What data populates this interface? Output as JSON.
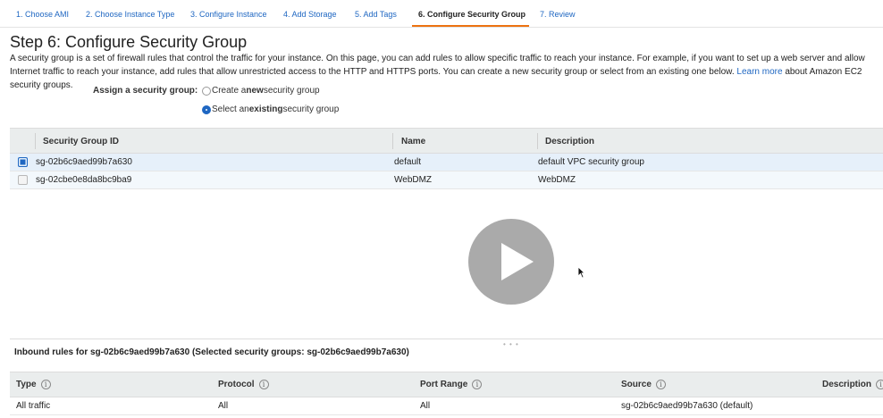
{
  "tabs": [
    {
      "label": "1. Choose AMI"
    },
    {
      "label": "2. Choose Instance Type"
    },
    {
      "label": "3. Configure Instance"
    },
    {
      "label": "4. Add Storage"
    },
    {
      "label": "5. Add Tags"
    },
    {
      "label": "6. Configure Security Group",
      "active": true
    },
    {
      "label": "7. Review"
    }
  ],
  "page": {
    "title": "Step 6: Configure Security Group",
    "description": "A security group is a set of firewall rules that control the traffic for your instance. On this page, you can add rules to allow specific traffic to reach your instance. For example, if you want to set up a web server and allow Internet traffic to reach your instance, add rules that allow unrestricted access to the HTTP and HTTPS ports. You can create a new security group or select from an existing one below.",
    "learn_more": "Learn more",
    "description_tail": "about Amazon EC2 security groups."
  },
  "assign": {
    "label": "Assign a security group:",
    "option_create_pre": "Create a ",
    "option_create_bold": "new",
    "option_create_post": " security group",
    "option_select_pre": "Select an ",
    "option_select_bold": "existing",
    "option_select_post": " security group",
    "selected": "existing"
  },
  "security_groups": {
    "columns": [
      "Security Group ID",
      "Name",
      "Description"
    ],
    "rows": [
      {
        "id": "sg-02b6c9aed99b7a630",
        "name": "default",
        "description": "default VPC security group",
        "checked": true
      },
      {
        "id": "sg-02cbe0e8da8bc9ba9",
        "name": "WebDMZ",
        "description": "WebDMZ",
        "checked": false
      }
    ]
  },
  "inbound": {
    "title": "Inbound rules for sg-02b6c9aed99b7a630 (Selected security groups: sg-02b6c9aed99b7a630)",
    "columns": [
      "Type",
      "Protocol",
      "Port Range",
      "Source",
      "Description"
    ],
    "rows": [
      {
        "type": "All traffic",
        "protocol": "All",
        "port_range": "All",
        "source": "sg-02b6c9aed99b7a630 (default)",
        "description": ""
      }
    ]
  },
  "icons": {
    "play": "play-icon",
    "info": "info-icon",
    "cursor": "mouse-pointer-icon"
  },
  "colors": {
    "link": "#1f67c2",
    "active_tab_underline": "#ec7211",
    "table_header_bg": "#eaeded",
    "selected_row_bg": "#e6f0fa"
  }
}
